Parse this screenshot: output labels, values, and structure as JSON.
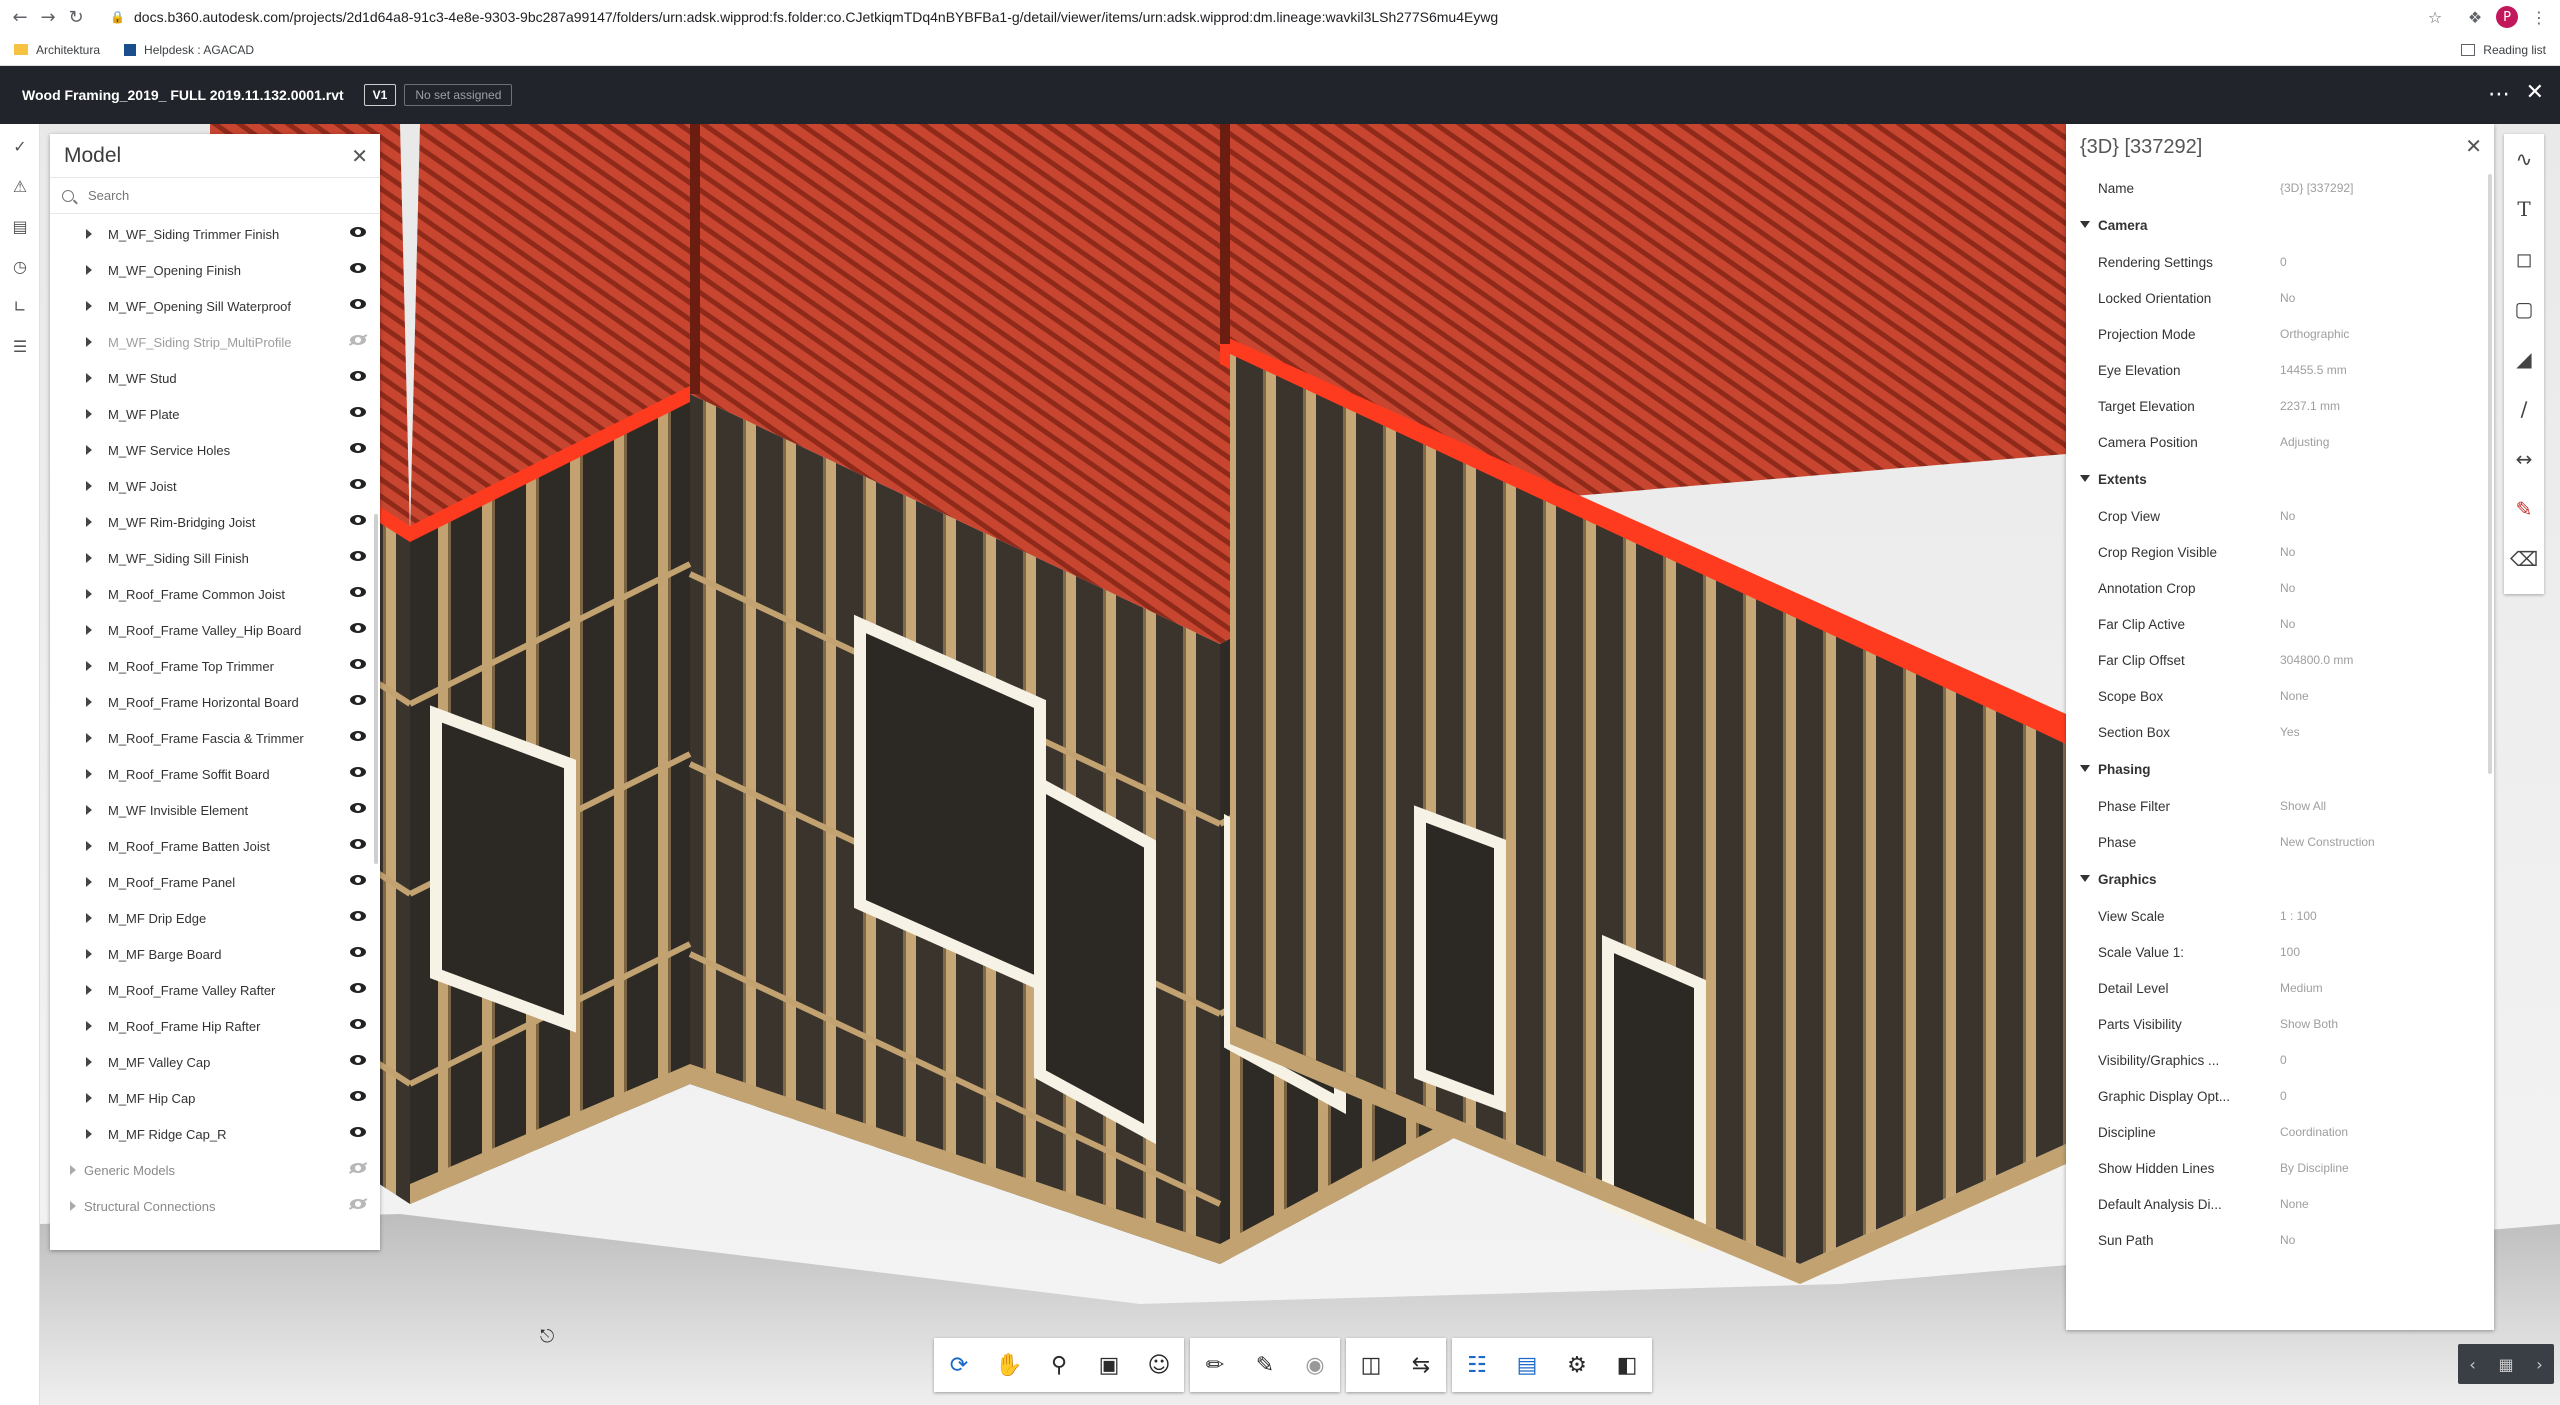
{
  "browser": {
    "url": "docs.b360.autodesk.com/projects/2d1d64a8-91c3-4e8e-9303-9bc287a99147/folders/urn:adsk.wipprod:fs.folder:co.CJetkiqmTDq4nBYBFBa1-g/detail/viewer/items/urn:adsk.wipprod:dm.lineage:wavkil3LSh277S6mu4Eywg",
    "profile_initial": "P",
    "bookmarks": [
      "Architektura",
      "Helpdesk : AGACAD"
    ],
    "reading_list": "Reading list"
  },
  "header": {
    "file_title": "Wood Framing_2019_ FULL 2019.11.132.0001.rvt",
    "version": "V1",
    "set_status": "No set assigned"
  },
  "model_panel": {
    "title": "Model",
    "search_placeholder": "Search",
    "items": [
      {
        "label": "M_WF_Siding Trimmer Finish",
        "visible": true
      },
      {
        "label": "M_WF_Opening Finish",
        "visible": true
      },
      {
        "label": "M_WF_Opening Sill Waterproof",
        "visible": true
      },
      {
        "label": "M_WF_Siding Strip_MultiProfile",
        "visible": false
      },
      {
        "label": "M_WF Stud",
        "visible": true
      },
      {
        "label": "M_WF Plate",
        "visible": true
      },
      {
        "label": "M_WF Service Holes",
        "visible": true
      },
      {
        "label": "M_WF Joist",
        "visible": true
      },
      {
        "label": "M_WF Rim-Bridging Joist",
        "visible": true
      },
      {
        "label": "M_WF_Siding Sill Finish",
        "visible": true
      },
      {
        "label": "M_Roof_Frame Common Joist",
        "visible": true
      },
      {
        "label": "M_Roof_Frame Valley_Hip Board",
        "visible": true
      },
      {
        "label": "M_Roof_Frame Top Trimmer",
        "visible": true
      },
      {
        "label": "M_Roof_Frame Horizontal Board",
        "visible": true
      },
      {
        "label": "M_Roof_Frame Fascia & Trimmer",
        "visible": true
      },
      {
        "label": "M_Roof_Frame Soffit Board",
        "visible": true
      },
      {
        "label": "M_WF Invisible Element",
        "visible": true
      },
      {
        "label": "M_Roof_Frame Batten Joist",
        "visible": true
      },
      {
        "label": "M_Roof_Frame Panel",
        "visible": true
      },
      {
        "label": "M_MF Drip Edge",
        "visible": true
      },
      {
        "label": "M_MF Barge Board",
        "visible": true
      },
      {
        "label": "M_Roof_Frame Valley Rafter",
        "visible": true
      },
      {
        "label": "M_Roof_Frame Hip Rafter",
        "visible": true
      },
      {
        "label": "M_MF Valley Cap",
        "visible": true
      },
      {
        "label": "M_MF Hip Cap",
        "visible": true
      },
      {
        "label": "M_MF Ridge Cap_R",
        "visible": true
      }
    ],
    "groups": [
      {
        "label": "Generic Models",
        "visible": false
      },
      {
        "label": "Structural Connections",
        "visible": false
      }
    ]
  },
  "properties_panel": {
    "title": "{3D} [337292]",
    "name_label": "Name",
    "name_value": "{3D} [337292]",
    "sections": [
      {
        "title": "Camera",
        "rows": [
          {
            "name": "Rendering Settings",
            "value": "0"
          },
          {
            "name": "Locked Orientation",
            "value": "No"
          },
          {
            "name": "Projection Mode",
            "value": "Orthographic"
          },
          {
            "name": "Eye Elevation",
            "value": "14455.5 mm"
          },
          {
            "name": "Target Elevation",
            "value": "2237.1 mm"
          },
          {
            "name": "Camera Position",
            "value": "Adjusting"
          }
        ]
      },
      {
        "title": "Extents",
        "rows": [
          {
            "name": "Crop View",
            "value": "No"
          },
          {
            "name": "Crop Region Visible",
            "value": "No"
          },
          {
            "name": "Annotation Crop",
            "value": "No"
          },
          {
            "name": "Far Clip Active",
            "value": "No"
          },
          {
            "name": "Far Clip Offset",
            "value": "304800.0 mm"
          },
          {
            "name": "Scope Box",
            "value": "None"
          },
          {
            "name": "Section Box",
            "value": "Yes"
          }
        ]
      },
      {
        "title": "Phasing",
        "rows": [
          {
            "name": "Phase Filter",
            "value": "Show All"
          },
          {
            "name": "Phase",
            "value": "New Construction"
          }
        ]
      },
      {
        "title": "Graphics",
        "rows": [
          {
            "name": "View Scale",
            "value": "1 : 100"
          },
          {
            "name": "Scale Value 1:",
            "value": "100"
          },
          {
            "name": "Detail Level",
            "value": "Medium"
          },
          {
            "name": "Parts Visibility",
            "value": "Show Both"
          },
          {
            "name": "Visibility/Graphics ...",
            "value": "0"
          },
          {
            "name": "Graphic Display Opt...",
            "value": "0"
          },
          {
            "name": "Discipline",
            "value": "Coordination"
          },
          {
            "name": "Show Hidden Lines",
            "value": "By Discipline"
          },
          {
            "name": "Default Analysis Di...",
            "value": "None"
          },
          {
            "name": "Sun Path",
            "value": "No"
          }
        ]
      }
    ]
  },
  "icons": {
    "back": "back-arrow-icon",
    "forward": "forward-arrow-icon",
    "reload": "reload-icon",
    "star": "star-icon",
    "extensions": "puzzle-icon",
    "more": "more-vert-icon"
  },
  "colors": {
    "header_bg": "#21252b",
    "roof": "#c8412c",
    "fascia": "#ff3b1f",
    "timber": "#b9955f",
    "accent": "#1b6ac9"
  }
}
